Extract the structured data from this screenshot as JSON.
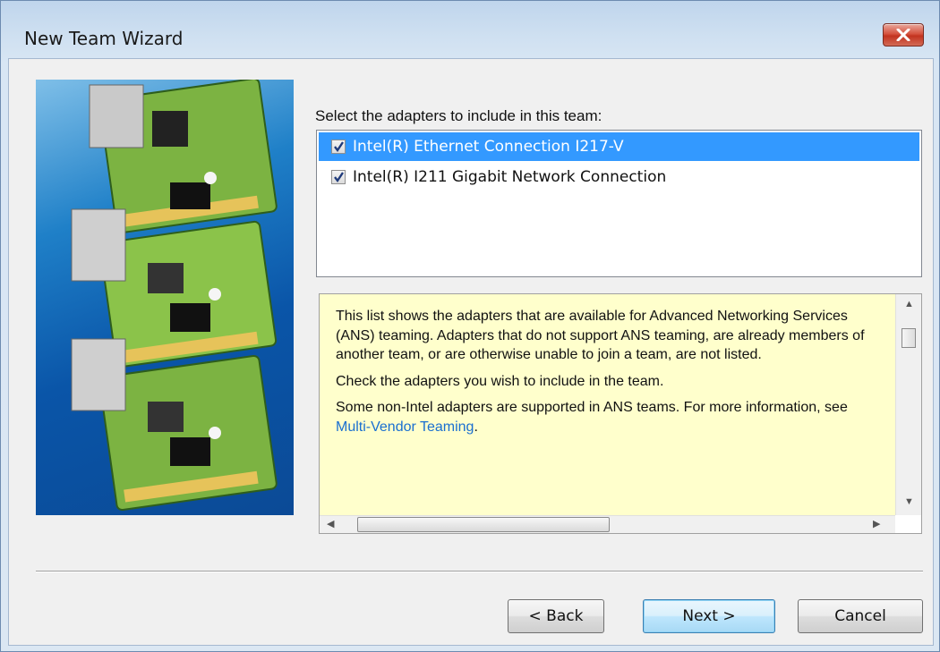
{
  "window": {
    "title": "New Team Wizard",
    "close_icon": "close-icon"
  },
  "prompt": "Select the adapters to include in this team:",
  "adapters": [
    {
      "label": "Intel(R) Ethernet Connection I217-V",
      "checked": true,
      "selected": true
    },
    {
      "label": "Intel(R) I211 Gigabit Network Connection",
      "checked": true,
      "selected": false
    }
  ],
  "info": {
    "paragraph1": "This list shows the adapters that are available for Advanced Networking Services (ANS) teaming. Adapters that do not support ANS teaming, are already members of another team, or are otherwise unable to join a team, are not listed.",
    "paragraph2": "Check the adapters you wish to include in the team.",
    "paragraph3_prefix": "Some non-Intel adapters are supported in ANS teams. For more information, see ",
    "paragraph3_link": "Multi-Vendor Teaming",
    "paragraph3_suffix": "."
  },
  "buttons": {
    "back": "< Back",
    "next": "Next >",
    "cancel": "Cancel"
  },
  "colors": {
    "selection": "#3399ff",
    "info_background": "#ffffcc",
    "link": "#1a6fd0",
    "close_button": "#c7402c"
  }
}
